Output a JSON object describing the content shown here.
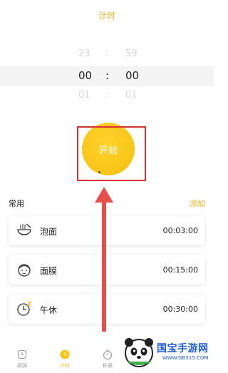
{
  "header": {
    "title": "计时"
  },
  "picker": {
    "prev": {
      "hours": "23",
      "minutes": "59"
    },
    "current": {
      "hours": "00",
      "minutes": "00"
    },
    "next": {
      "hours": "01",
      "minutes": "01"
    },
    "separator": ":"
  },
  "start_button": {
    "label": "开始"
  },
  "presets": {
    "title": "常用",
    "add_label": "添加",
    "items": [
      {
        "label": "泡面",
        "time": "00:03:00",
        "icon": "noodle-bowl-icon"
      },
      {
        "label": "面膜",
        "time": "00:15:00",
        "icon": "face-mask-icon"
      },
      {
        "label": "午休",
        "time": "00:30:00",
        "icon": "nap-clock-icon"
      }
    ]
  },
  "nav": {
    "items": [
      {
        "label": "闹钟",
        "icon": "alarm-icon"
      },
      {
        "label": "计时",
        "icon": "timer-icon",
        "active": true
      },
      {
        "label": "秒表",
        "icon": "stopwatch-icon"
      }
    ]
  },
  "watermark": {
    "text": "国宝手游网",
    "url": "WWW.GB315.COM"
  },
  "colors": {
    "accent": "#f0b41a",
    "highlight": "#d9312f",
    "arrow": "#e84f4a"
  }
}
